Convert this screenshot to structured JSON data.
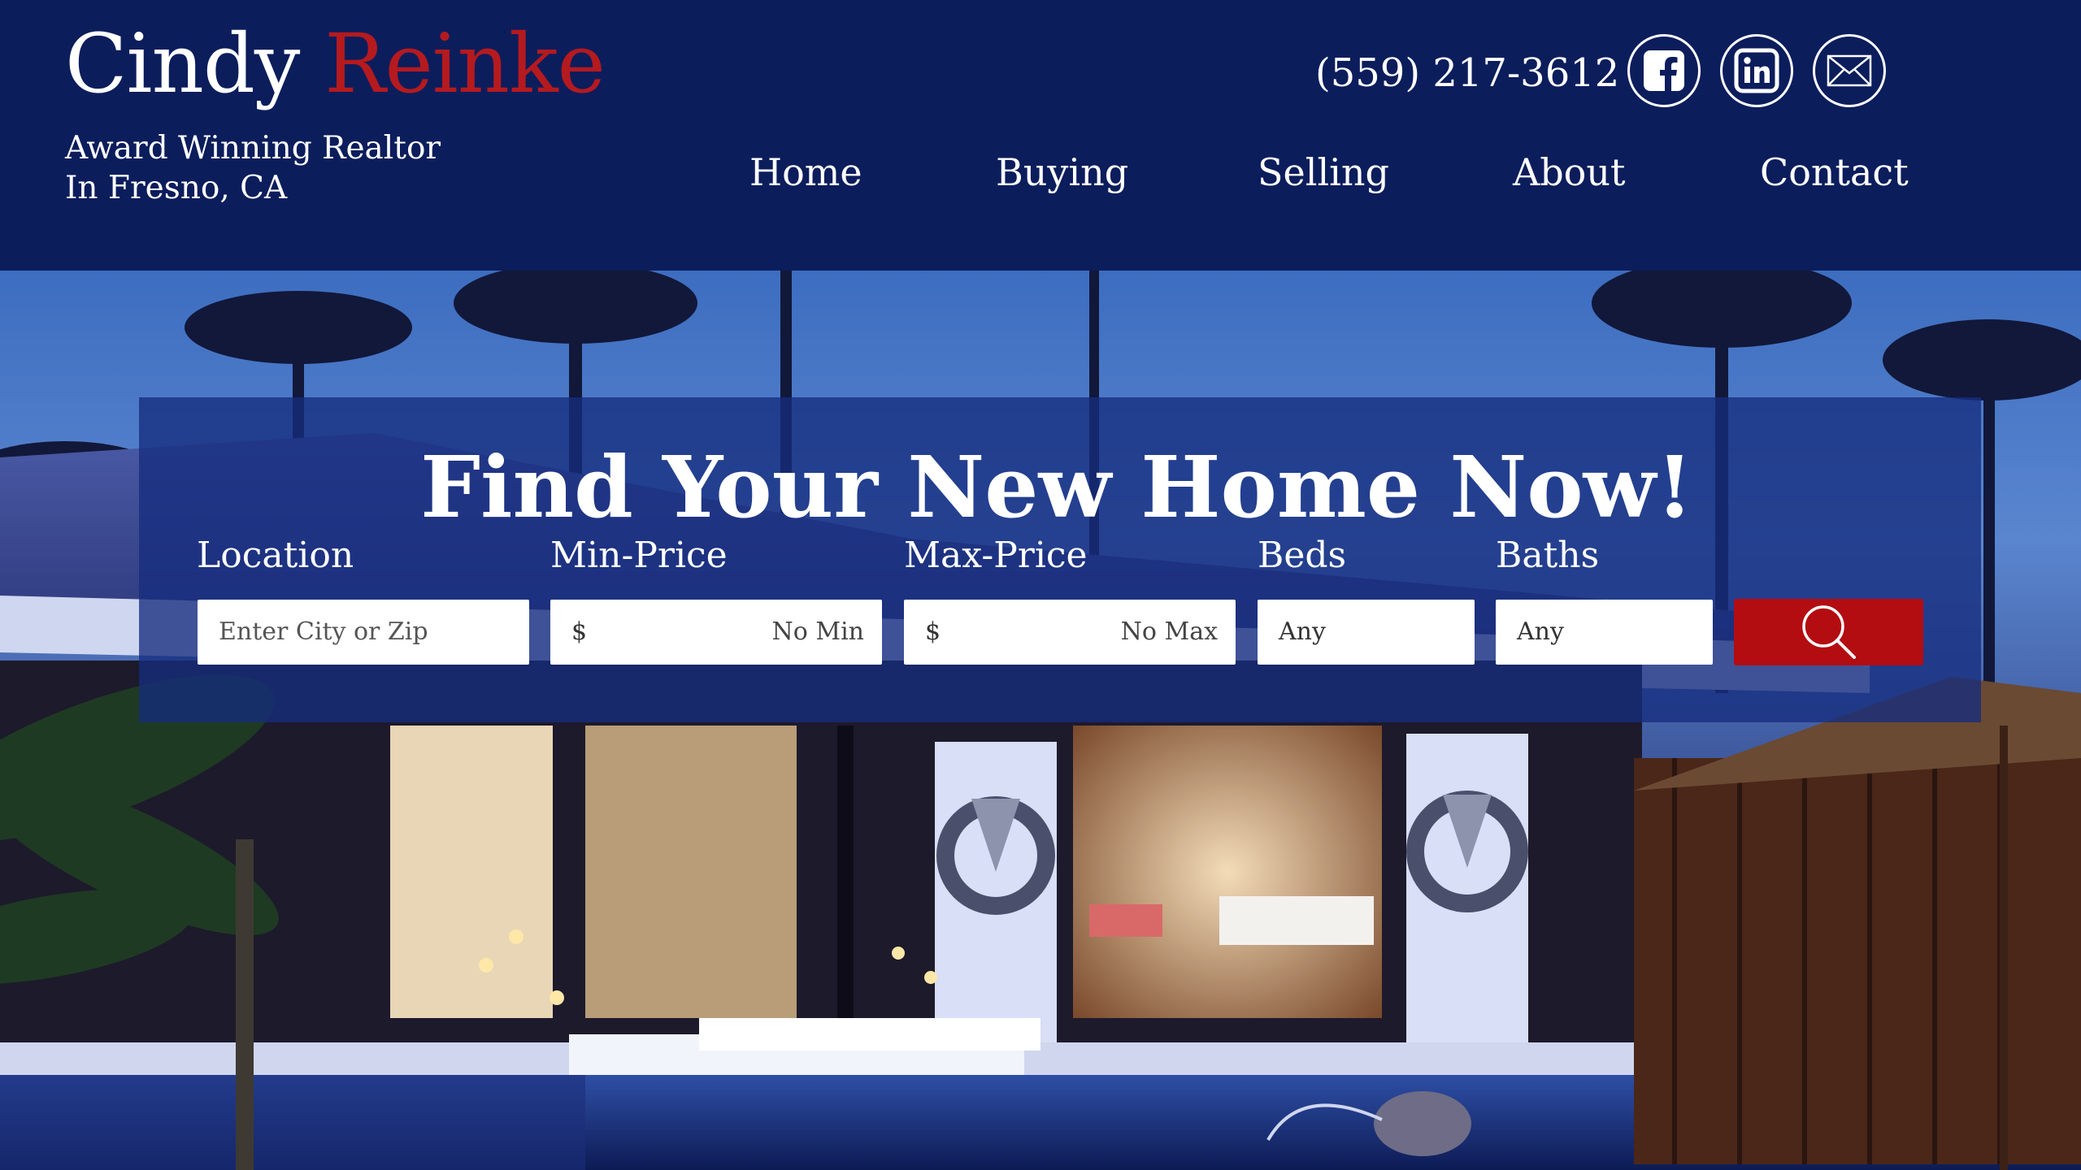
{
  "header": {
    "first_name": "Cindy",
    "last_name": "Reinke",
    "tagline_line1": "Award Winning Realtor",
    "tagline_line2": "In Fresno, CA",
    "phone": "(559) 217-3612",
    "social": [
      "facebook-icon",
      "linkedin-icon",
      "mail-icon"
    ]
  },
  "nav": {
    "items": [
      {
        "label": "Home"
      },
      {
        "label": "Buying"
      },
      {
        "label": "Selling"
      },
      {
        "label": "About"
      },
      {
        "label": "Contact"
      }
    ]
  },
  "search": {
    "title": "Find Your New Home Now!",
    "location": {
      "label": "Location",
      "placeholder": "Enter City or Zip"
    },
    "min_price": {
      "label": "Min-Price",
      "currency": "$",
      "value": "No Min"
    },
    "max_price": {
      "label": "Max-Price",
      "currency": "$",
      "value": "No Max"
    },
    "beds": {
      "label": "Beds",
      "value": "Any"
    },
    "baths": {
      "label": "Baths",
      "value": "Any"
    },
    "button_icon": "search-icon"
  },
  "colors": {
    "header_bg": "#0c1d5c",
    "accent_red": "#b51a1f",
    "search_button": "#b30d12",
    "panel_overlay": "rgba(22,45,125,0.78)"
  }
}
